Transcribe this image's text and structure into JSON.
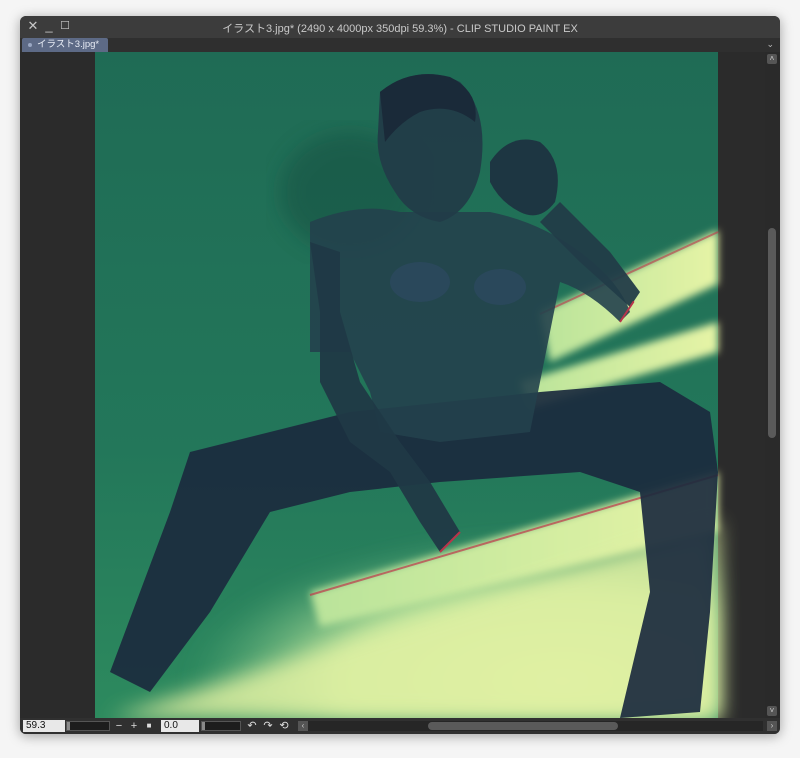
{
  "window": {
    "title": "イラスト3.jpg* (2490 x 4000px 350dpi 59.3%)  - CLIP STUDIO PAINT EX",
    "controls": {
      "close": "✕",
      "minimize": "_",
      "maximize": "☐"
    }
  },
  "tabs": [
    {
      "label": "イラスト3.jpg*",
      "active": true
    }
  ],
  "canvas": {
    "description_icon": "artwork-canvas",
    "colors": {
      "background_green": "#1d6a52",
      "light_stripe": "#d9ef9c",
      "figure_dark": "#1c2c3e",
      "pasteboard": "#2b2b2b"
    }
  },
  "statusbar": {
    "zoom_value": "59.3",
    "zoom_out": "−",
    "zoom_in": "+",
    "fit": "■",
    "rotation_value": "0.0",
    "rotate_left": "↶",
    "rotate_right": "↷",
    "reset_rotation": "⟲",
    "scroll_left": "‹",
    "scroll_right": "›"
  },
  "vscroll": {
    "up": "˄",
    "down": "˅"
  },
  "tab_menu": "⌄"
}
